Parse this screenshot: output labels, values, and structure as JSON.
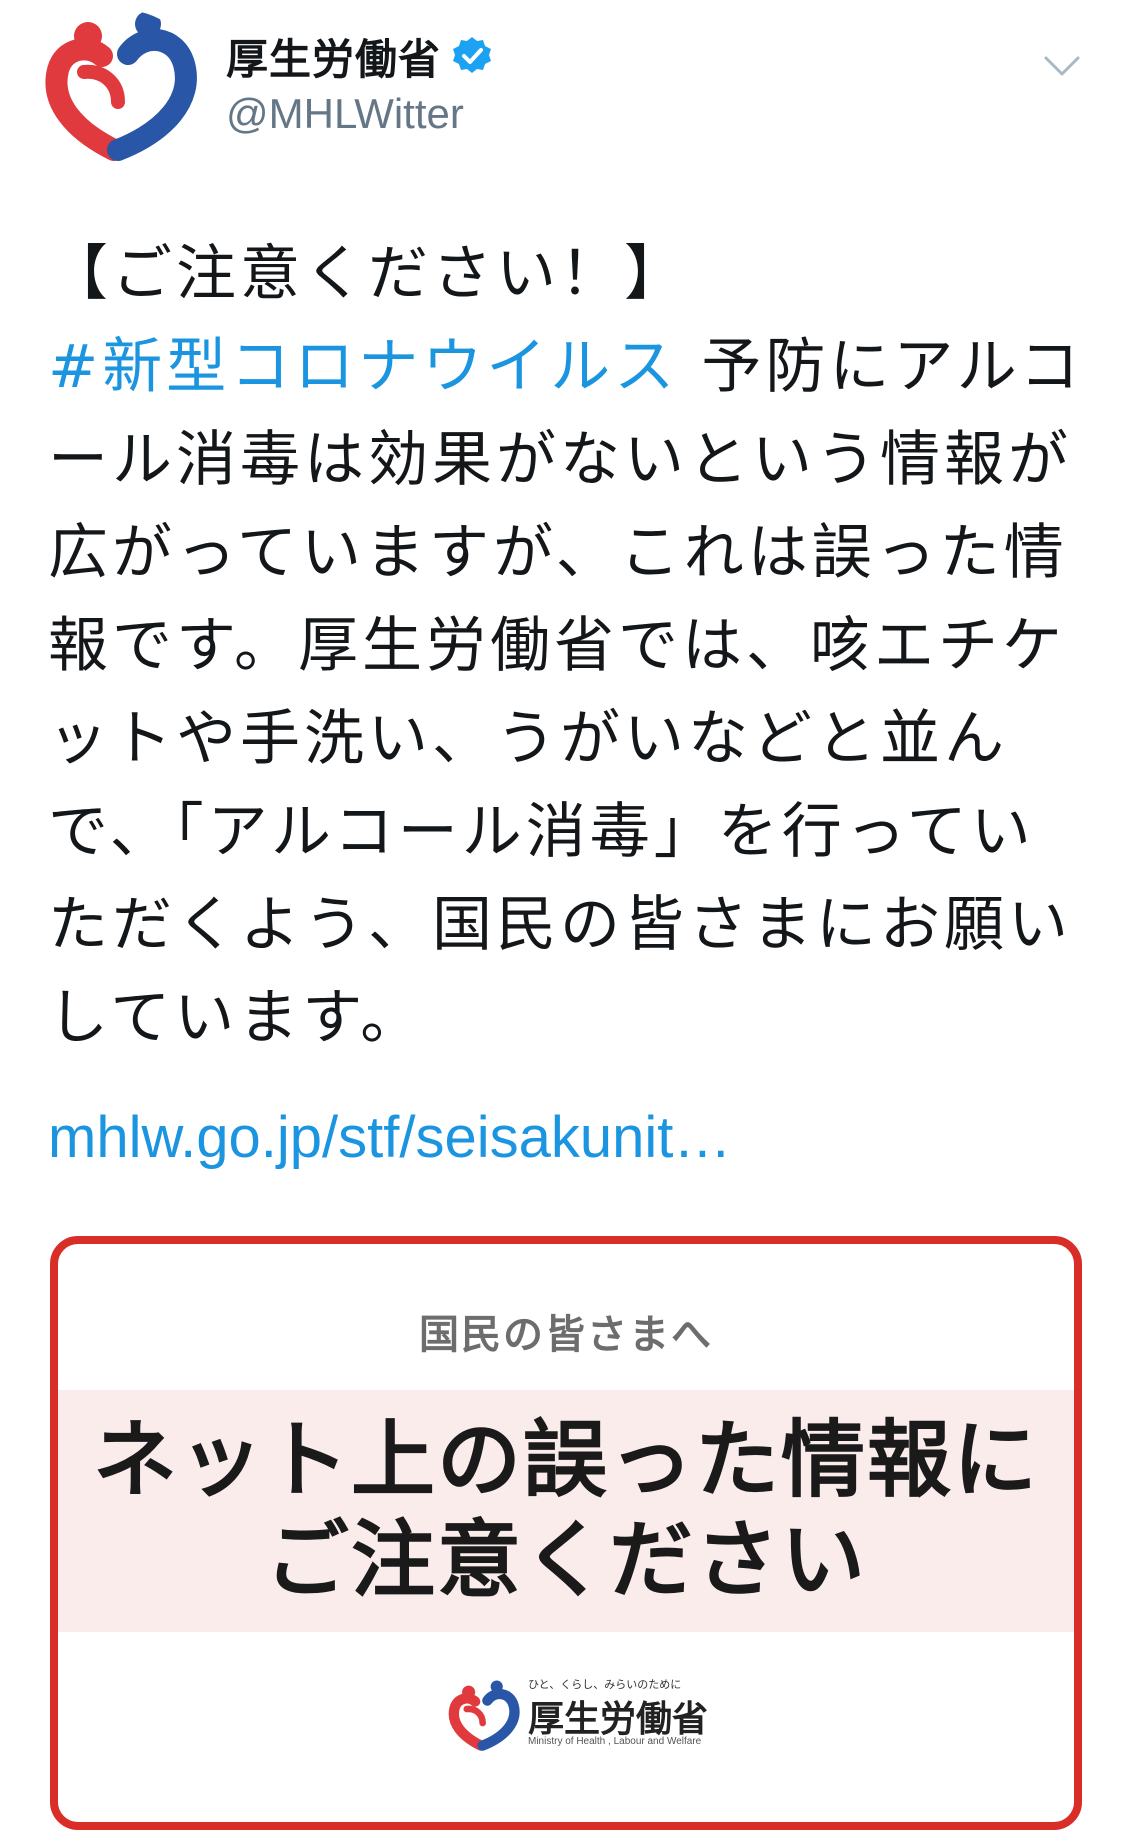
{
  "account": {
    "display_name": "厚生労働省",
    "handle": "@MHLWitter",
    "verified": true,
    "avatar_icon": "mhlw-logo-icon"
  },
  "tweet": {
    "lines": [
      [
        {
          "text": "【ご注意ください！】",
          "type": "text"
        }
      ],
      [
        {
          "text": "#新型コロナウイルス",
          "type": "hashtag"
        },
        {
          "text": " 予防にアルコ",
          "type": "text"
        }
      ],
      [
        {
          "text": "ール消毒は効果がないという情報が",
          "type": "text"
        }
      ],
      [
        {
          "text": "広がっていますが、これは誤った情",
          "type": "text"
        }
      ],
      [
        {
          "text": "報です。厚生労働省では、咳エチケ",
          "type": "text"
        }
      ],
      [
        {
          "text": "ットや手洗い、うがいなどと並ん",
          "type": "text"
        }
      ],
      [
        {
          "text": "で、「アルコール消毒」を行ってい",
          "type": "text"
        }
      ],
      [
        {
          "text": "ただくよう、国民の皆さまにお願い",
          "type": "text"
        }
      ],
      [
        {
          "text": "しています。",
          "type": "text"
        }
      ]
    ],
    "link": "mhlw.go.jp/stf/seisakunit…"
  },
  "media_card": {
    "subtitle": "国民の皆さまへ",
    "headline_line1": "ネット上の誤った情報に",
    "headline_line2": "ご注意ください",
    "logo_tagline": "ひと、くらし、みらいのために",
    "logo_name": "厚生労働省",
    "logo_english": "Ministry of Health , Labour and Welfare"
  },
  "colors": {
    "link_blue": "#1b95e0",
    "card_border_red": "#d92d27",
    "card_band_pink": "#fbecec",
    "verified_blue": "#1da1f2",
    "logo_red": "#e03a3e",
    "logo_blue": "#2a56a8"
  }
}
